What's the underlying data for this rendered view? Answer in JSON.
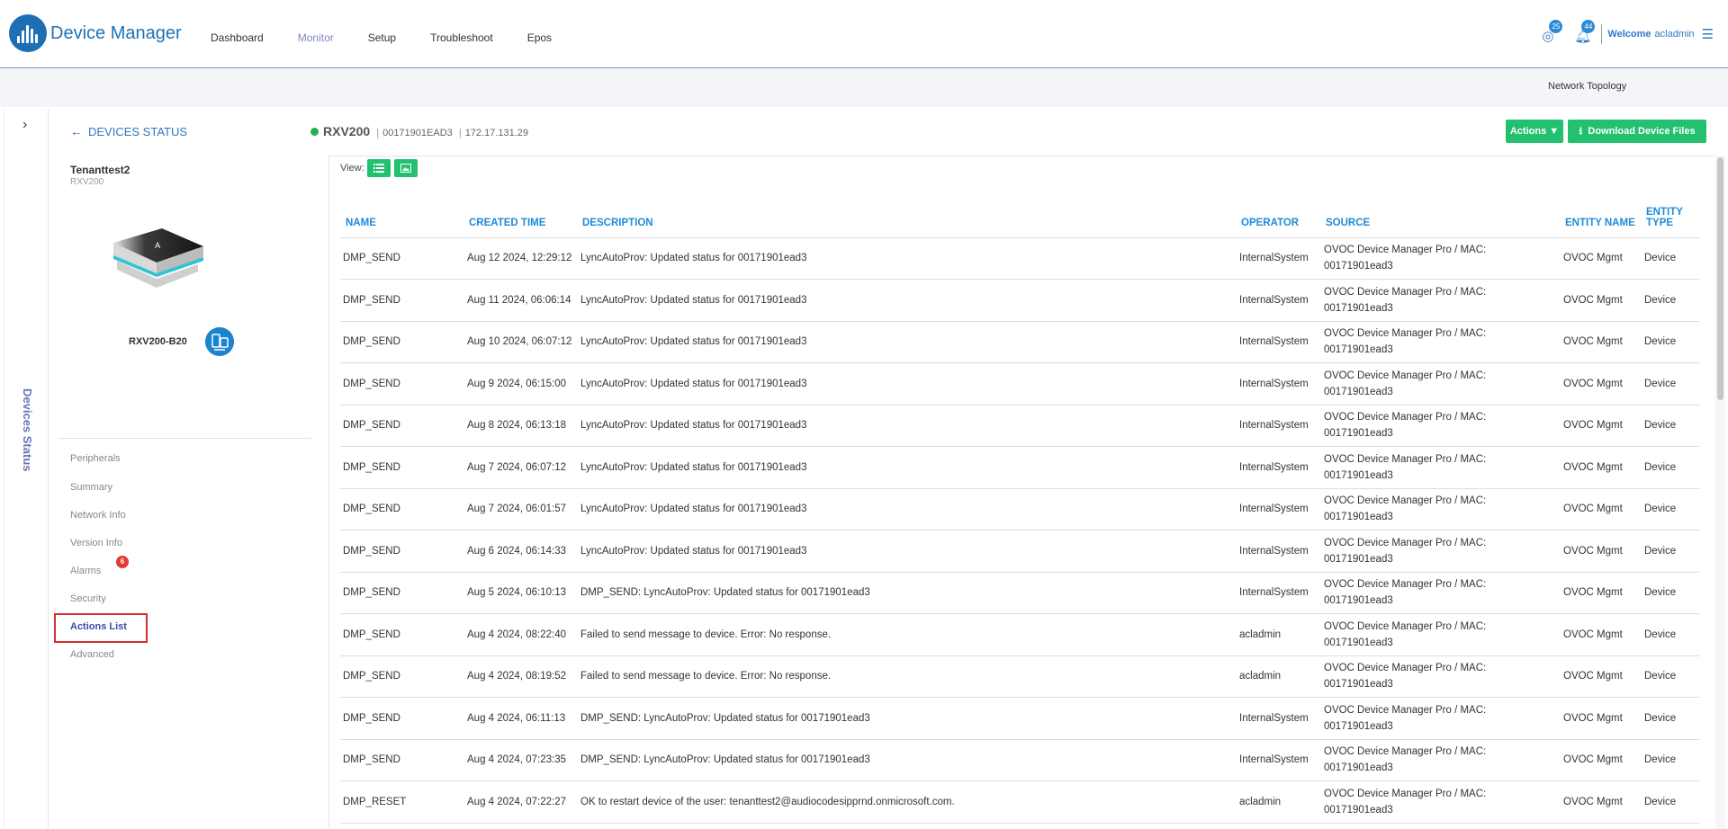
{
  "header": {
    "app_title": "Device Manager",
    "nav": [
      "Dashboard",
      "Monitor",
      "Setup",
      "Troubleshoot",
      "Epos"
    ],
    "active_nav": "Monitor",
    "notifications": {
      "count": "25",
      "icon": "globe-notification-icon"
    },
    "alerts": {
      "count": "44",
      "icon": "bell-icon"
    },
    "welcome": "Welcome",
    "user": "acladmin",
    "colors": {
      "brand": "#1d72b8",
      "active_nav": "#7e86c5"
    }
  },
  "subheader": {
    "network_topology": "Network Topology"
  },
  "rail": {
    "label": "Devices Status",
    "toggle_icon": "chevron-right-icon"
  },
  "device_panel": {
    "back_label": "DEVICES STATUS",
    "tenant": "Tenanttest2",
    "tenant_model": "RXV200",
    "device_name": "RXV200-B20",
    "menu": {
      "peripherals": "Peripherals",
      "summary": "Summary",
      "network_info": "Network Info",
      "version_info": "Version Info",
      "alarms": "Alarms",
      "alarms_badge": "6",
      "security": "Security",
      "actions_list": "Actions List",
      "advanced": "Advanced"
    },
    "active_menu": "Actions List"
  },
  "device_header": {
    "status": "online",
    "status_color": "#22b14c",
    "title": "RXV200",
    "mac": "00171901EAD3",
    "ip": "172.17.131.29"
  },
  "toolbar": {
    "actions_label": "Actions ▼",
    "download_label": "Download Device Files",
    "view_label": "View:",
    "accent": "#22c06f"
  },
  "table": {
    "columns": {
      "name": "NAME",
      "created_time": "CREATED TIME",
      "description": "DESCRIPTION",
      "operator": "OPERATOR",
      "source": "SOURCE",
      "entity_name": "ENTITY NAME",
      "entity_type": "ENTITY TYPE"
    },
    "rows": [
      {
        "name": "DMP_SEND",
        "created_time": "Aug 12 2024, 12:29:12",
        "description": "LyncAutoProv: Updated status for 00171901ead3",
        "operator": "InternalSystem",
        "source": "OVOC Device Manager Pro / MAC: 00171901ead3",
        "entity_name": "OVOC Mgmt",
        "entity_type": "Device"
      },
      {
        "name": "DMP_SEND",
        "created_time": "Aug 11 2024, 06:06:14",
        "description": "LyncAutoProv: Updated status for 00171901ead3",
        "operator": "InternalSystem",
        "source": "OVOC Device Manager Pro / MAC: 00171901ead3",
        "entity_name": "OVOC Mgmt",
        "entity_type": "Device"
      },
      {
        "name": "DMP_SEND",
        "created_time": "Aug 10 2024, 06:07:12",
        "description": "LyncAutoProv: Updated status for 00171901ead3",
        "operator": "InternalSystem",
        "source": "OVOC Device Manager Pro / MAC: 00171901ead3",
        "entity_name": "OVOC Mgmt",
        "entity_type": "Device"
      },
      {
        "name": "DMP_SEND",
        "created_time": "Aug 9 2024, 06:15:00",
        "description": "LyncAutoProv: Updated status for 00171901ead3",
        "operator": "InternalSystem",
        "source": "OVOC Device Manager Pro / MAC: 00171901ead3",
        "entity_name": "OVOC Mgmt",
        "entity_type": "Device"
      },
      {
        "name": "DMP_SEND",
        "created_time": "Aug 8 2024, 06:13:18",
        "description": "LyncAutoProv: Updated status for 00171901ead3",
        "operator": "InternalSystem",
        "source": "OVOC Device Manager Pro / MAC: 00171901ead3",
        "entity_name": "OVOC Mgmt",
        "entity_type": "Device"
      },
      {
        "name": "DMP_SEND",
        "created_time": "Aug 7 2024, 06:07:12",
        "description": "LyncAutoProv: Updated status for 00171901ead3",
        "operator": "InternalSystem",
        "source": "OVOC Device Manager Pro / MAC: 00171901ead3",
        "entity_name": "OVOC Mgmt",
        "entity_type": "Device"
      },
      {
        "name": "DMP_SEND",
        "created_time": "Aug 7 2024, 06:01:57",
        "description": "LyncAutoProv: Updated status for 00171901ead3",
        "operator": "InternalSystem",
        "source": "OVOC Device Manager Pro / MAC: 00171901ead3",
        "entity_name": "OVOC Mgmt",
        "entity_type": "Device"
      },
      {
        "name": "DMP_SEND",
        "created_time": "Aug 6 2024, 06:14:33",
        "description": "LyncAutoProv: Updated status for 00171901ead3",
        "operator": "InternalSystem",
        "source": "OVOC Device Manager Pro / MAC: 00171901ead3",
        "entity_name": "OVOC Mgmt",
        "entity_type": "Device"
      },
      {
        "name": "DMP_SEND",
        "created_time": "Aug 5 2024, 06:10:13",
        "description": "DMP_SEND: LyncAutoProv: Updated status for 00171901ead3",
        "operator": "InternalSystem",
        "source": "OVOC Device Manager Pro / MAC: 00171901ead3",
        "entity_name": "OVOC Mgmt",
        "entity_type": "Device"
      },
      {
        "name": "DMP_SEND",
        "created_time": "Aug 4 2024, 08:22:40",
        "description": "Failed to send message to device. Error: No response.",
        "operator": "acladmin",
        "source": "OVOC Device Manager Pro / MAC: 00171901ead3",
        "entity_name": "OVOC Mgmt",
        "entity_type": "Device"
      },
      {
        "name": "DMP_SEND",
        "created_time": "Aug 4 2024, 08:19:52",
        "description": "Failed to send message to device. Error: No response.",
        "operator": "acladmin",
        "source": "OVOC Device Manager Pro / MAC: 00171901ead3",
        "entity_name": "OVOC Mgmt",
        "entity_type": "Device"
      },
      {
        "name": "DMP_SEND",
        "created_time": "Aug 4 2024, 06:11:13",
        "description": "DMP_SEND: LyncAutoProv: Updated status for 00171901ead3",
        "operator": "InternalSystem",
        "source": "OVOC Device Manager Pro / MAC: 00171901ead3",
        "entity_name": "OVOC Mgmt",
        "entity_type": "Device"
      },
      {
        "name": "DMP_SEND",
        "created_time": "Aug 4 2024, 07:23:35",
        "description": "DMP_SEND: LyncAutoProv: Updated status for 00171901ead3",
        "operator": "InternalSystem",
        "source": "OVOC Device Manager Pro / MAC: 00171901ead3",
        "entity_name": "OVOC Mgmt",
        "entity_type": "Device"
      },
      {
        "name": "DMP_RESET",
        "created_time": "Aug 4 2024, 07:22:27",
        "description": "OK to restart device of the user: tenanttest2@audiocodesipprnd.onmicrosoft.com.",
        "operator": "acladmin",
        "source": "OVOC Device Manager Pro / MAC: 00171901ead3",
        "entity_name": "OVOC Mgmt",
        "entity_type": "Device"
      }
    ]
  }
}
